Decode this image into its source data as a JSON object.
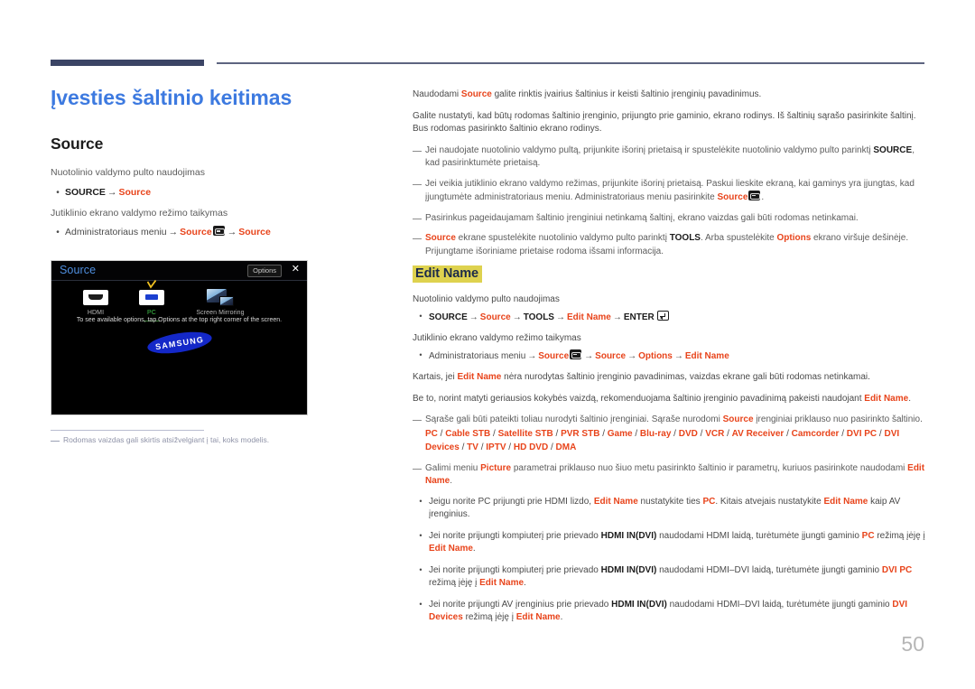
{
  "document": {
    "page_number": "50",
    "title": "Įvesties šaltinio keitimas"
  },
  "left": {
    "section_title": "Source",
    "remote_intro": "Nuotolinio valdymo pulto naudojimas",
    "remote_path": {
      "step1": "SOURCE",
      "arrow": "→",
      "step2": "Source"
    },
    "touch_intro": "Jutiklinio ekrano valdymo režimo taikymas",
    "touch_path": {
      "step1": "Administratoriaus meniu",
      "arrow": "→",
      "step2": "Source",
      "badge": "source-badge-icon",
      "step3": "Source"
    },
    "footnote": "Rodomas vaizdas gali skirtis atsižvelgiant į tai, koks modelis."
  },
  "screenshot": {
    "title": "Source",
    "options_label": "Options",
    "close_label": "✕",
    "sources": [
      {
        "label": "HDMI",
        "icon": "hdmi-icon",
        "selected": false
      },
      {
        "label": "PC",
        "icon": "pc-vga-icon",
        "selected": true
      },
      {
        "label": "Screen Mirroring",
        "icon": "screen-mirroring-icon",
        "selected": false
      }
    ],
    "hint": "To see available options, tap Options at the top right corner of the screen.",
    "logo_text": "SAMSUNG",
    "logo_color": "#1428c8"
  },
  "right": {
    "intro1": {
      "a": "Naudodami ",
      "kw1": "Source",
      "b": " galite rinktis įvairius šaltinius ir keisti šaltinio įrenginių pavadinimus."
    },
    "intro2": "Galite nustatyti, kad būtų rodomas šaltinio įrenginio, prijungto prie gaminio, ekrano rodinys. Iš šaltinių sąrašo pasirinkite šaltinį. Bus rodomas pasirinkto šaltinio ekrano rodinys.",
    "notes": [
      {
        "a": "Jei naudojate nuotolinio valdymo pultą, prijunkite išorinį prietaisą ir spustelėkite nuotolinio valdymo pulto parinktį ",
        "kw1": "SOURCE",
        "b": ", kad pasirinktumėte prietaisą."
      },
      {
        "a": "Jei veikia jutiklinio ekrano valdymo režimas, prijunkite išorinį prietaisą. Paskui lieskite ekraną, kai gaminys yra įjungtas, kad įjungtumėte administratoriaus meniu. Administratoriaus meniu pasirinkite ",
        "kw1": "Source",
        "b": "."
      },
      {
        "a": "Pasirinkus pageidaujamam šaltinio įrenginiui netinkamą šaltinį, ekrano vaizdas gali būti rodomas netinkamai.",
        "kw1": "",
        "b": ""
      },
      {
        "a": "",
        "kw1": "Source",
        "mid": " ekrane spustelėkite nuotolinio valdymo pulto parinktį ",
        "kw2": "TOOLS",
        "mid2": ". Arba spustelėkite ",
        "kw3": "Options",
        "b": " ekrano viršuje dešinėje. Prijungtame išoriniame prietaise rodoma išsami informacija."
      }
    ],
    "edit_name": {
      "heading": "Edit Name",
      "remote_intro": "Nuotolinio valdymo pulto naudojimas",
      "remote_path": {
        "s1": "SOURCE",
        "s2": "Source",
        "s3": "TOOLS",
        "s4": "Edit Name",
        "s5": "ENTER",
        "arrow": "→"
      },
      "touch_intro": "Jutiklinio ekrano valdymo režimo taikymas",
      "touch_path": {
        "s1": "Administratoriaus meniu",
        "s2": "Source",
        "s3": "Source",
        "s4": "Options",
        "s5": "Edit Name",
        "arrow": "→"
      },
      "para1": {
        "a": "Kartais, jei ",
        "kw1": "Edit Name",
        "b": " nėra nurodytas šaltinio įrenginio pavadinimas, vaizdas ekrane gali būti rodomas netinkamai."
      },
      "para2": {
        "a": "Be to, norint matyti geriausios kokybės vaizdą, rekomenduojama šaltinio įrenginio pavadinimą pakeisti naudojant ",
        "kw1": "Edit Name",
        "b": "."
      },
      "note_list": {
        "a": "Sąraše gali būti pateikti toliau nurodyti šaltinio įrenginiai. Sąraše nurodomi ",
        "kw1": "Source",
        "b": " įrenginiai priklauso nuo pasirinkto šaltinio.",
        "devices": [
          "PC",
          "Cable STB",
          "Satellite STB",
          "PVR STB",
          "Game",
          "Blu-ray",
          "DVD",
          "VCR",
          "AV Receiver",
          "Camcorder",
          "DVI PC",
          "DVI Devices",
          "TV",
          "IPTV",
          "HD DVD",
          "DMA"
        ]
      },
      "note_picture": {
        "a": "Galimi meniu ",
        "kw1": "Picture",
        "b": " parametrai priklauso nuo šiuo metu pasirinkto šaltinio ir parametrų, kuriuos pasirinkote naudodami ",
        "kw2": "Edit Name",
        "c": "."
      },
      "bullets": [
        {
          "a": "Jeigu norite PC prijungti prie HDMI lizdo, ",
          "kw1": "Edit Name",
          "b": " nustatykite ties ",
          "kw2": "PC",
          "c": ". Kitais atvejais nustatykite ",
          "kw3": "Edit Name",
          "d": " kaip AV įrenginius."
        },
        {
          "a": "Jei norite prijungti kompiuterį prie prievado ",
          "kw1": "HDMI IN(DVI)",
          "b": " naudodami HDMI laidą, turėtumėte įjungti gaminio ",
          "kw2": "PC",
          "c": " režimą įėję į ",
          "kw3": "Edit Name",
          "d": "."
        },
        {
          "a": "Jei norite prijungti kompiuterį prie prievado ",
          "kw1": "HDMI IN(DVI)",
          "b": " naudodami HDMI–DVI laidą, turėtumėte įjungti gaminio ",
          "kw2": "DVI PC",
          "c": " režimą įėję į ",
          "kw3": "Edit Name",
          "d": "."
        },
        {
          "a": "Jei norite prijungti AV įrenginius prie prievado ",
          "kw1": "HDMI IN(DVI)",
          "b": " naudodami HDMI–DVI laidą, turėtumėte įjungti gaminio ",
          "kw2": "DVI Devices",
          "c": " režimą įėję į ",
          "kw3": "Edit Name",
          "d": "."
        }
      ]
    }
  },
  "colors": {
    "title_blue": "#3d7ae0",
    "keyword_red": "#e8441b",
    "header_navy": "#3b4465",
    "highlight_yellow": "#ded24f"
  }
}
